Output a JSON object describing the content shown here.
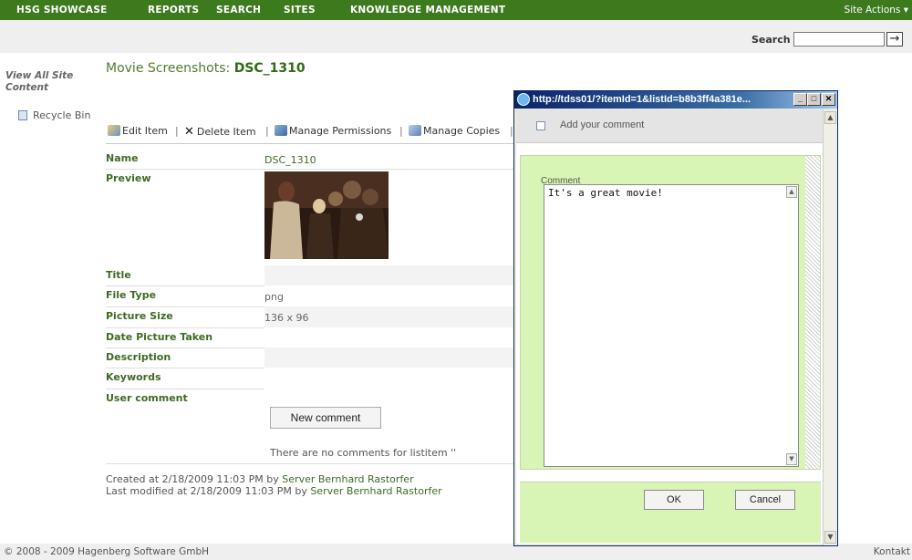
{
  "nav": {
    "items": [
      "HSG SHOWCASE",
      "REPORTS",
      "SEARCH",
      "SITES",
      "KNOWLEDGE MANAGEMENT"
    ],
    "site_actions": "Site Actions ▾"
  },
  "search": {
    "label": "Search",
    "go_glyph": "→"
  },
  "leftnav": {
    "view_all": "View All Site Content",
    "recycle_bin": "Recycle Bin"
  },
  "page": {
    "title_prefix": "Movie Screenshots: ",
    "title_item": "DSC_1310"
  },
  "toolbar": {
    "edit": "Edit Item",
    "delete": "Delete Item",
    "permissions": "Manage Permissions",
    "copies": "Manage Copies",
    "separator": "|"
  },
  "fields": {
    "name_label": "Name",
    "name_value": "DSC_1310",
    "preview_label": "Preview",
    "title_label": "Title",
    "filetype_label": "File Type",
    "filetype_value": "png",
    "size_label": "Picture Size",
    "size_value": "136 x 96",
    "date_label": "Date Picture Taken",
    "description_label": "Description",
    "keywords_label": "Keywords",
    "usercomment_label": "User comment"
  },
  "comments": {
    "new_button": "New comment",
    "none_text": "There are no comments for listitem ''"
  },
  "meta": {
    "created_prefix": "Created at 2/18/2009 11:03 PM  by ",
    "created_by": "Server Bernhard Rastorfer",
    "modified_prefix": "Last modified at 2/18/2009 11:03 PM  by ",
    "modified_by": "Server Bernhard Rastorfer"
  },
  "footer": {
    "copyright": "© 2008 - 2009 Hagenberg Software GmbH",
    "contact": "Kontakt"
  },
  "popup": {
    "title": "http://tdss01/?itemId=1&listId=b8b3ff4a381e...",
    "header": "Add your comment",
    "comment_label": "Comment",
    "comment_value": "It's a great movie!",
    "ok": "OK",
    "cancel": "Cancel"
  }
}
